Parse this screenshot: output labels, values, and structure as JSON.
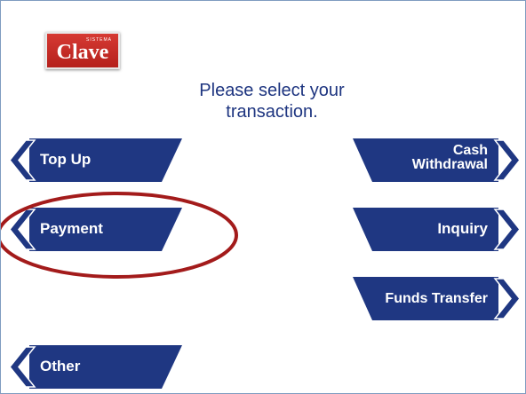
{
  "logo": {
    "small_text": "SISTEMA",
    "main_text": "Clave"
  },
  "prompt": {
    "line1": "Please select your",
    "line2": "transaction."
  },
  "buttons": {
    "top_up": "Top Up",
    "payment": "Payment",
    "other": "Other",
    "cash_withdrawal_line1": "Cash",
    "cash_withdrawal_line2": "Withdrawal",
    "inquiry": "Inquiry",
    "funds_transfer": "Funds Transfer"
  },
  "icons": {
    "left_arrow": "chevron-left-icon",
    "right_arrow": "chevron-right-icon"
  },
  "colors": {
    "button_fill": "#1f3782",
    "chevron_fill": "#1f3782",
    "prompt_text": "#1e3580",
    "highlight_stroke": "#a31b1b",
    "logo_red": "#c62a25"
  }
}
